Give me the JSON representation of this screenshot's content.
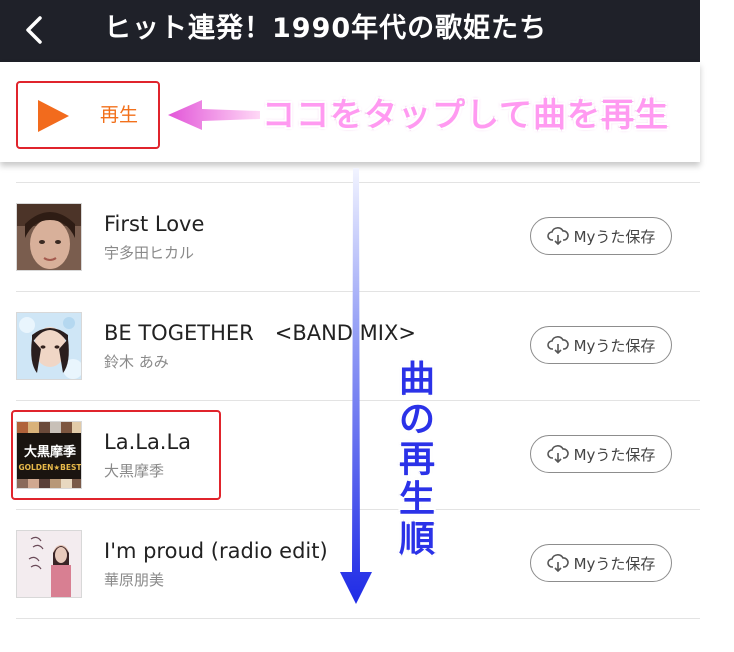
{
  "header": {
    "title": "ヒット連発！1990年代の歌姫たち",
    "back_icon": "chevron-left-icon"
  },
  "play_bar": {
    "label": "再生",
    "play_color": "#f26b1d"
  },
  "annotations": {
    "tap_hint": "ココをタップして曲を再生",
    "order_chars": [
      "曲",
      "の",
      "再",
      "生",
      "順"
    ]
  },
  "songs": [
    {
      "title": "First Love",
      "artist": "宇多田ヒカル",
      "save_label": "Myうた保存"
    },
    {
      "title": "BE TOGETHER　<BAND MIX>",
      "artist": "鈴木 あみ",
      "save_label": "Myうた保存"
    },
    {
      "title": "La.La.La",
      "artist": "大黒摩季",
      "save_label": "Myうた保存",
      "cover_text": {
        "name": "大黒摩季",
        "sub": "GOLDEN★BEST"
      }
    },
    {
      "title": "I'm proud (radio edit)",
      "artist": "華原朋美",
      "save_label": "Myうた保存"
    }
  ],
  "colors": {
    "header_bg": "#1f2129",
    "highlight": "#e0242c",
    "play_orange": "#f2711c",
    "hint_pink": "#ff9af1",
    "flow_blue": "#2b32e8"
  }
}
